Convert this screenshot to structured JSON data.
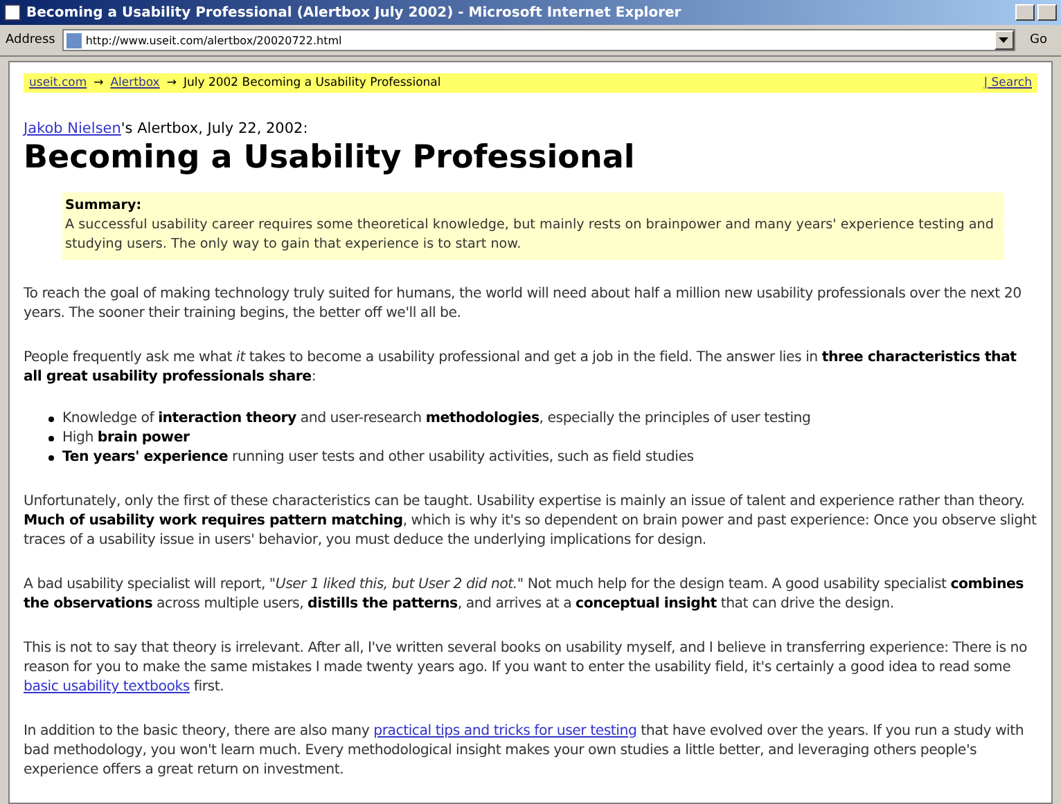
{
  "window": {
    "title": "Becoming a Usability Professional (Alertbox July 2002) - Microsoft Internet Explorer"
  },
  "address_bar": {
    "label": "Address",
    "value": "http://www.useit.com/alertbox/20020722.html",
    "go": "Go"
  },
  "breadcrumb": {
    "items": [
      {
        "kind": "link",
        "text": "useit.com"
      },
      {
        "kind": "sep",
        "text": "→"
      },
      {
        "kind": "link",
        "text": "Alertbox"
      },
      {
        "kind": "sep",
        "text": "→"
      },
      {
        "kind": "text",
        "text": "July 2002 Becoming a Usability Professional"
      }
    ],
    "search": "| Search"
  },
  "byline": {
    "author": "Jakob Nielsen",
    "rest": "'s Alertbox, July 22, 2002:"
  },
  "heading": "Becoming a Usability Professional",
  "summary": {
    "label": "Summary:",
    "text": "A successful usability career requires some theoretical knowledge, but mainly rests on brainpower and many years' experience testing and studying users. The only way to gain that experience is to start now."
  },
  "blocks": [
    {
      "kind": "para",
      "parts": [
        {
          "kind": "text",
          "text": "To reach the goal of making technology truly suited for humans, the world will need about half a million new usability professionals over the next 20 years. The sooner their training begins, the better off we'll all be."
        }
      ]
    },
    {
      "kind": "para",
      "parts": [
        {
          "kind": "text",
          "text": "People frequently ask me what *it* takes to become a usability professional and get a job in the field. The answer lies in **three characteristics that all great usability professionals share**:"
        }
      ]
    },
    {
      "kind": "list",
      "items": [
        "Knowledge of **interaction theory** and user-research **methodologies**, especially the principles of user testing",
        "High **brain power**",
        "**Ten years' experience** running user tests and other usability activities, such as field studies"
      ]
    },
    {
      "kind": "para",
      "parts": [
        {
          "kind": "text",
          "text": "Unfortunately, only the first of these characteristics can be taught. Usability expertise is mainly an issue of talent and experience rather than theory. **Much of usability work requires pattern matching**, which is why it's so dependent on brain power and past experience: Once you observe slight traces of a usability issue in users' behavior, you must deduce the underlying implications for design."
        }
      ]
    },
    {
      "kind": "para",
      "parts": [
        {
          "kind": "text",
          "text": "A bad usability specialist will report, \"*User 1 liked this, but User 2 did not.*\" Not much help for the design team. A good usability specialist **combines the observations** across multiple users, **distills the patterns**, and arrives at a **conceptual insight** that can drive the design."
        }
      ]
    },
    {
      "kind": "para",
      "parts": [
        {
          "kind": "text",
          "text": "This is not to say that theory is irrelevant. After all, I've written several books on usability myself, and I believe in transferring experience: There is no reason for you to make the same mistakes I made twenty years ago. If you want to enter the usability field, it's certainly a good idea to read some "
        },
        {
          "kind": "link",
          "text": "basic usability textbooks"
        },
        {
          "kind": "text",
          "text": " first."
        }
      ]
    },
    {
      "kind": "para",
      "parts": [
        {
          "kind": "text",
          "text": "In addition to the basic theory, there are also many "
        },
        {
          "kind": "link",
          "text": "practical tips and tricks for user testing"
        },
        {
          "kind": "text",
          "text": " that have evolved over the years. If you run a study with bad methodology, you won't learn much. Every methodological insight makes your own studies a little better, and leveraging others people's experience offers a great return on investment."
        }
      ]
    }
  ]
}
